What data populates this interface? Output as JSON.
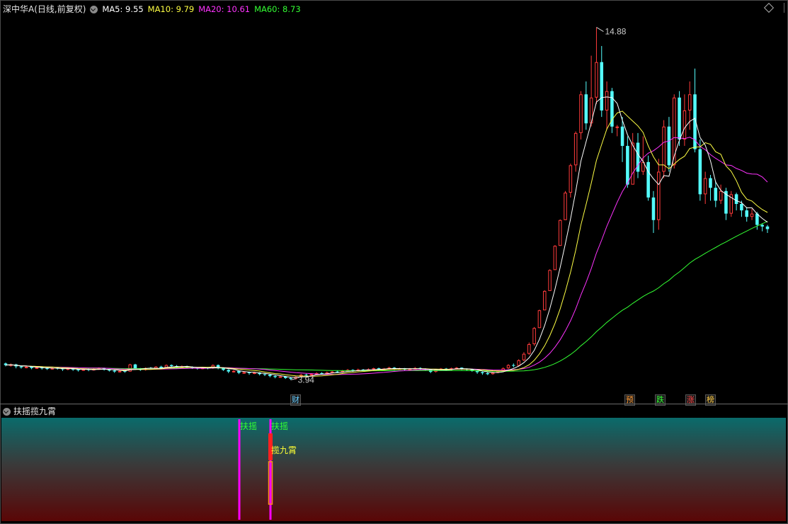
{
  "header": {
    "title": "深中华A(日线,前复权)",
    "ma5": "MA5: 9.55",
    "ma10": "MA10: 9.79",
    "ma20": "MA20: 10.61",
    "ma60": "MA60: 8.73"
  },
  "indicator": {
    "name": "扶摇揽九霄",
    "signals": [
      {
        "label": "扶摇",
        "color": "#33ff33"
      },
      {
        "label": "扶摇",
        "color": "#33ff33"
      },
      {
        "label": "揽九霄",
        "color": "#ffff33"
      }
    ]
  },
  "events": [
    {
      "label": "财",
      "color": "#66ccff"
    },
    {
      "label": "预",
      "color": "#ff9933"
    },
    {
      "label": "跌",
      "color": "#33ff33"
    },
    {
      "label": "涨",
      "color": "#ff4444"
    },
    {
      "label": "榜",
      "color": "#ffcc44"
    }
  ],
  "colors": {
    "up": "#ff3b3b",
    "down": "#54ffff",
    "ma5": "#ffffff",
    "ma10": "#ffff44",
    "ma20": "#ff33ff",
    "ma60": "#33ff33",
    "signal_line": "#ff00ff"
  },
  "chart_data": {
    "type": "candlestick",
    "series_note": "daily OHLC, forward-adjusted",
    "annotations": {
      "high": "14.88",
      "low": "3.94"
    },
    "ylim": [
      3.6,
      15.2
    ],
    "candles": [
      [
        4.45,
        4.4,
        4.48,
        4.36
      ],
      [
        4.4,
        4.42,
        4.45,
        4.35
      ],
      [
        4.42,
        4.36,
        4.44,
        4.3
      ],
      [
        4.36,
        4.33,
        4.38,
        4.29
      ],
      [
        4.33,
        4.35,
        4.37,
        4.3
      ],
      [
        4.35,
        4.31,
        4.36,
        4.27
      ],
      [
        4.31,
        4.33,
        4.35,
        4.28
      ],
      [
        4.33,
        4.3,
        4.35,
        4.26
      ],
      [
        4.3,
        4.28,
        4.32,
        4.25
      ],
      [
        4.28,
        4.31,
        4.33,
        4.26
      ],
      [
        4.31,
        4.29,
        4.34,
        4.26
      ],
      [
        4.29,
        4.27,
        4.31,
        4.22
      ],
      [
        4.27,
        4.3,
        4.33,
        4.24
      ],
      [
        4.3,
        4.26,
        4.31,
        4.22
      ],
      [
        4.26,
        4.24,
        4.28,
        4.2
      ],
      [
        4.24,
        4.27,
        4.29,
        4.22
      ],
      [
        4.27,
        4.25,
        4.3,
        4.21
      ],
      [
        4.25,
        4.28,
        4.3,
        4.23
      ],
      [
        4.28,
        4.3,
        4.33,
        4.25
      ],
      [
        4.3,
        4.26,
        4.32,
        4.23
      ],
      [
        4.26,
        4.23,
        4.28,
        4.2
      ],
      [
        4.23,
        4.2,
        4.25,
        4.16
      ],
      [
        4.2,
        4.22,
        4.24,
        4.17
      ],
      [
        4.22,
        4.2,
        4.24,
        4.16
      ],
      [
        4.2,
        4.42,
        4.44,
        4.19
      ],
      [
        4.42,
        4.28,
        4.44,
        4.25
      ],
      [
        4.28,
        4.25,
        4.31,
        4.22
      ],
      [
        4.25,
        4.31,
        4.33,
        4.23
      ],
      [
        4.31,
        4.29,
        4.34,
        4.26
      ],
      [
        4.29,
        4.35,
        4.37,
        4.27
      ],
      [
        4.35,
        4.3,
        4.38,
        4.27
      ],
      [
        4.3,
        4.4,
        4.42,
        4.28
      ],
      [
        4.4,
        4.37,
        4.42,
        4.33
      ],
      [
        4.37,
        4.34,
        4.4,
        4.31
      ],
      [
        4.34,
        4.36,
        4.39,
        4.32
      ],
      [
        4.36,
        4.33,
        4.38,
        4.3
      ],
      [
        4.33,
        4.31,
        4.36,
        4.28
      ],
      [
        4.31,
        4.29,
        4.33,
        4.26
      ],
      [
        4.29,
        4.32,
        4.34,
        4.27
      ],
      [
        4.32,
        4.3,
        4.34,
        4.27
      ],
      [
        4.3,
        4.4,
        4.42,
        4.28
      ],
      [
        4.4,
        4.3,
        4.42,
        4.27
      ],
      [
        4.3,
        4.25,
        4.33,
        4.22
      ],
      [
        4.25,
        4.2,
        4.27,
        4.15
      ],
      [
        4.2,
        4.22,
        4.25,
        4.17
      ],
      [
        4.22,
        4.16,
        4.24,
        4.12
      ],
      [
        4.16,
        4.18,
        4.21,
        4.13
      ],
      [
        4.18,
        4.15,
        4.2,
        4.1
      ],
      [
        4.15,
        4.17,
        4.19,
        4.12
      ],
      [
        4.17,
        4.12,
        4.18,
        4.08
      ],
      [
        4.12,
        4.1,
        4.14,
        4.06
      ],
      [
        4.1,
        4.06,
        4.12,
        4.02
      ],
      [
        4.06,
        4.03,
        4.08,
        3.99
      ],
      [
        4.03,
        4.05,
        4.08,
        4.01
      ],
      [
        4.05,
        4.0,
        4.06,
        3.97
      ],
      [
        4.0,
        3.97,
        4.02,
        3.94
      ],
      [
        3.97,
        4.04,
        4.06,
        3.95
      ],
      [
        4.04,
        4.1,
        4.13,
        4.02
      ],
      [
        4.1,
        4.08,
        4.13,
        4.05
      ],
      [
        4.08,
        4.12,
        4.15,
        4.06
      ],
      [
        4.12,
        4.15,
        4.18,
        4.1
      ],
      [
        4.15,
        4.13,
        4.18,
        4.1
      ],
      [
        4.13,
        4.17,
        4.2,
        4.11
      ],
      [
        4.17,
        4.2,
        4.22,
        4.14
      ],
      [
        4.2,
        4.18,
        4.23,
        4.15
      ],
      [
        4.18,
        4.22,
        4.25,
        4.16
      ],
      [
        4.22,
        4.25,
        4.28,
        4.2
      ],
      [
        4.25,
        4.23,
        4.27,
        4.19
      ],
      [
        4.23,
        4.26,
        4.29,
        4.21
      ],
      [
        4.26,
        4.24,
        4.28,
        4.21
      ],
      [
        4.24,
        4.27,
        4.3,
        4.22
      ],
      [
        4.27,
        4.3,
        4.32,
        4.24
      ],
      [
        4.3,
        4.27,
        4.32,
        4.24
      ],
      [
        4.27,
        4.29,
        4.31,
        4.25
      ],
      [
        4.29,
        4.32,
        4.35,
        4.27
      ],
      [
        4.32,
        4.28,
        4.34,
        4.25
      ],
      [
        4.28,
        4.3,
        4.32,
        4.26
      ],
      [
        4.3,
        4.26,
        4.31,
        4.23
      ],
      [
        4.26,
        4.29,
        4.31,
        4.24
      ],
      [
        4.29,
        4.31,
        4.34,
        4.27
      ],
      [
        4.31,
        4.28,
        4.33,
        4.25
      ],
      [
        4.28,
        4.25,
        4.3,
        4.22
      ],
      [
        4.25,
        4.19,
        4.27,
        4.15
      ],
      [
        4.19,
        4.26,
        4.28,
        4.17
      ],
      [
        4.26,
        4.29,
        4.31,
        4.24
      ],
      [
        4.29,
        4.26,
        4.31,
        4.23
      ],
      [
        4.26,
        4.3,
        4.32,
        4.24
      ],
      [
        4.3,
        4.32,
        4.34,
        4.27
      ],
      [
        4.32,
        4.28,
        4.33,
        4.25
      ],
      [
        4.28,
        4.26,
        4.3,
        4.22
      ],
      [
        4.26,
        4.22,
        4.28,
        4.19
      ],
      [
        4.22,
        4.18,
        4.23,
        4.13
      ],
      [
        4.18,
        4.15,
        4.2,
        4.1
      ],
      [
        4.15,
        4.12,
        4.18,
        4.09
      ],
      [
        4.12,
        4.17,
        4.19,
        4.1
      ],
      [
        4.17,
        4.22,
        4.25,
        4.15
      ],
      [
        4.22,
        4.3,
        4.33,
        4.2
      ],
      [
        4.3,
        4.4,
        4.43,
        4.28
      ],
      [
        4.4,
        4.38,
        4.45,
        4.33
      ],
      [
        4.38,
        4.55,
        4.58,
        4.36
      ],
      [
        4.55,
        4.75,
        4.8,
        4.52
      ],
      [
        4.75,
        5.05,
        5.1,
        4.72
      ],
      [
        5.05,
        5.55,
        5.58,
        5.0
      ],
      [
        5.55,
        6.1,
        6.12,
        5.55
      ],
      [
        6.1,
        6.7,
        6.72,
        6.1
      ],
      [
        6.7,
        7.35,
        7.37,
        6.7
      ],
      [
        7.35,
        8.1,
        8.12,
        7.35
      ],
      [
        8.1,
        8.9,
        8.92,
        8.1
      ],
      [
        8.9,
        9.75,
        9.8,
        8.9
      ],
      [
        9.75,
        10.6,
        10.65,
        9.6
      ],
      [
        10.6,
        11.6,
        11.65,
        10.4
      ],
      [
        11.6,
        12.8,
        12.9,
        11.4
      ],
      [
        12.8,
        11.9,
        13.2,
        11.7
      ],
      [
        11.9,
        12.7,
        14.0,
        11.8
      ],
      [
        12.7,
        13.8,
        14.88,
        12.5
      ],
      [
        13.8,
        12.3,
        14.3,
        12.1
      ],
      [
        12.3,
        12.9,
        13.2,
        11.7
      ],
      [
        12.9,
        11.8,
        13.0,
        11.6
      ],
      [
        11.8,
        11.8,
        11.85,
        11.5
      ],
      [
        11.8,
        11.2,
        12.1,
        10.7
      ],
      [
        11.2,
        10.0,
        11.5,
        9.9
      ],
      [
        10.0,
        11.3,
        11.6,
        10.1
      ],
      [
        11.3,
        10.4,
        11.6,
        10.2
      ],
      [
        10.4,
        10.7,
        11.5,
        10.3
      ],
      [
        10.7,
        9.6,
        10.9,
        9.5
      ],
      [
        9.6,
        8.9,
        9.8,
        8.5
      ],
      [
        8.9,
        10.4,
        10.8,
        8.6
      ],
      [
        10.4,
        11.8,
        12.0,
        10.2
      ],
      [
        11.8,
        10.6,
        12.1,
        10.4
      ],
      [
        10.6,
        12.7,
        12.8,
        10.5
      ],
      [
        12.7,
        11.4,
        12.9,
        11.2
      ],
      [
        11.4,
        12.3,
        12.8,
        11.2
      ],
      [
        12.3,
        12.8,
        13.2,
        11.7
      ],
      [
        12.8,
        11.1,
        13.6,
        11.0
      ],
      [
        11.1,
        9.7,
        11.4,
        9.5
      ],
      [
        9.7,
        10.2,
        10.4,
        9.4
      ],
      [
        10.2,
        9.9,
        10.3,
        9.5
      ],
      [
        9.9,
        9.5,
        10.1,
        9.3
      ],
      [
        9.5,
        9.8,
        10.0,
        9.4
      ],
      [
        9.8,
        9.1,
        9.9,
        8.9
      ],
      [
        9.1,
        9.7,
        9.8,
        9.0
      ],
      [
        9.7,
        9.4,
        9.75,
        9.2
      ],
      [
        9.4,
        9.2,
        9.5,
        9.0
      ],
      [
        9.2,
        9.0,
        9.3,
        8.85
      ],
      [
        9.0,
        9.1,
        9.25,
        8.9
      ],
      [
        9.1,
        8.75,
        9.15,
        8.6
      ],
      [
        8.75,
        8.7,
        8.8,
        8.55
      ],
      [
        8.7,
        8.62,
        8.75,
        8.5
      ]
    ]
  }
}
